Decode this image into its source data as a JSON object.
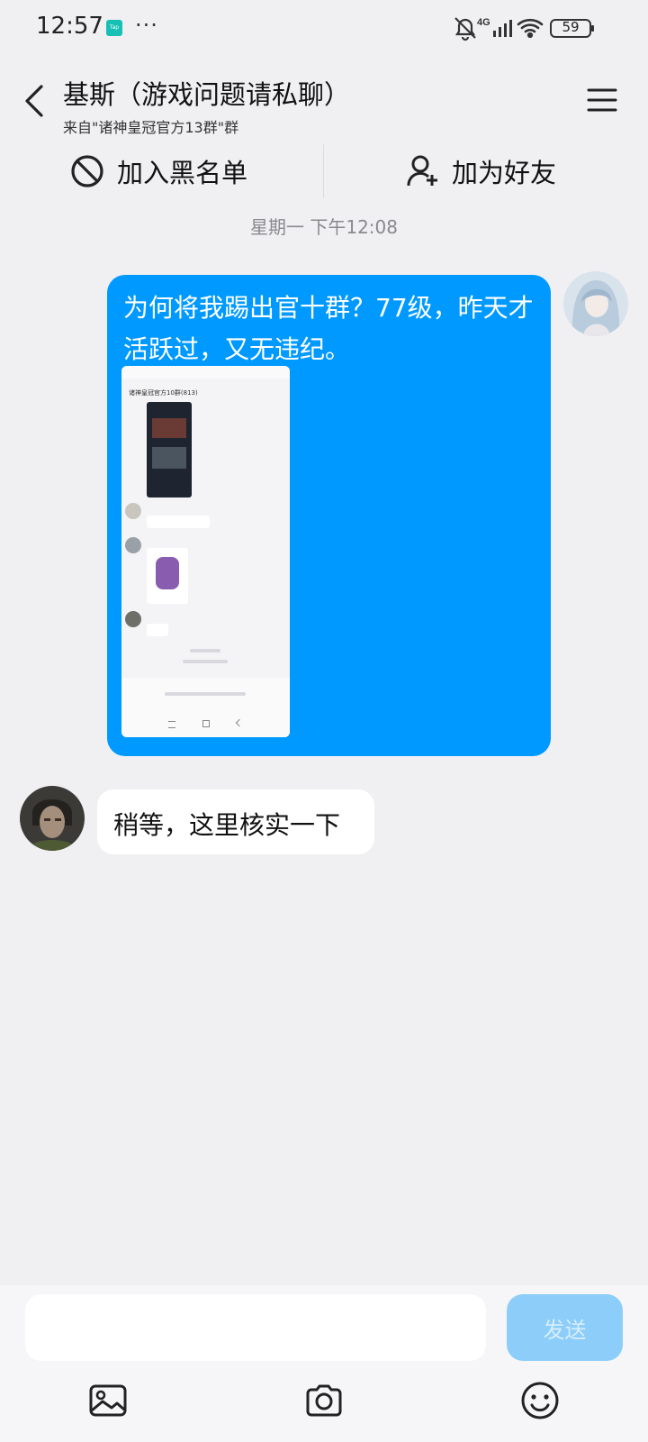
{
  "status_bar": {
    "time": "12:57",
    "app_badge": "Tap",
    "dots": "···",
    "network": "4G",
    "battery": "59"
  },
  "header": {
    "title": "基斯（游戏问题请私聊）",
    "subtitle": "来自\"诸神皇冠官方13群\"群",
    "back_icon": "chevron-left-icon",
    "menu_icon": "hamburger-menu-icon"
  },
  "actions": {
    "blacklist_label": "加入黑名单",
    "add_friend_label": "加为好友"
  },
  "chat": {
    "timestamp": "星期一 下午12:08",
    "messages": [
      {
        "side": "right",
        "text": "为何将我踢出官十群？77级，昨天才活跃过，又无违纪。",
        "image_title": "诸神皇冠官方10群(813)"
      },
      {
        "side": "left",
        "text": "稍等，这里核实一下"
      }
    ]
  },
  "composer": {
    "input_value": "",
    "input_placeholder": "",
    "send_label": "发送"
  },
  "colors": {
    "accent": "#0099ff",
    "background": "#f0f0f3",
    "send_disabled": "#8ccdf9"
  }
}
